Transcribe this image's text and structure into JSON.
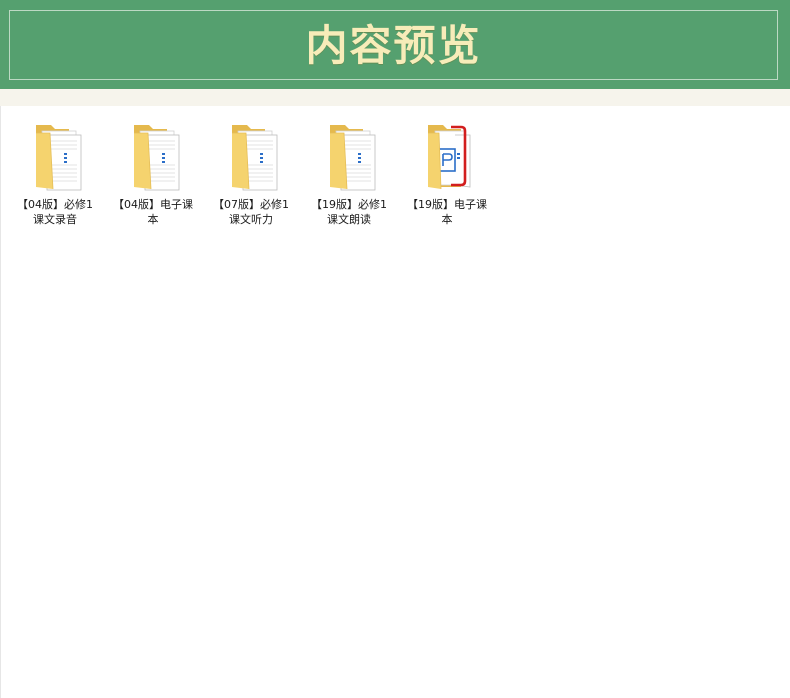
{
  "header": {
    "title": "内容预览"
  },
  "colors": {
    "banner_bg": "#55a06f",
    "banner_title": "#f7ecb9",
    "folder_yellow": "#f5d36e",
    "pdf_red": "#d21e1e",
    "doc_blue": "#2b6ec8"
  },
  "files": {
    "items": [
      {
        "label": "【04版】必修1课文录音",
        "icon": "folder-icon"
      },
      {
        "label": "【04版】电子课本",
        "icon": "folder-icon"
      },
      {
        "label": "【07版】必修1课文听力",
        "icon": "folder-icon"
      },
      {
        "label": "【19版】必修1课文朗读",
        "icon": "folder-icon"
      },
      {
        "label": "【19版】电子课本",
        "icon": "folder-pdf-icon"
      }
    ]
  }
}
